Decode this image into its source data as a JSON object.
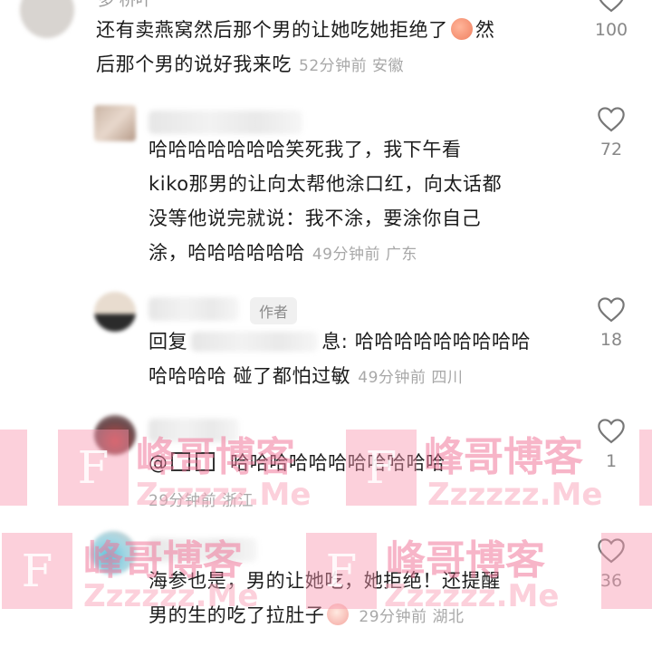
{
  "comments": [
    {
      "text_line1": "还有卖燕窝然后那个男的让她吃她拒绝了",
      "text_line2_prefix": "然",
      "text_line2": "后那个男的说好我来吃",
      "meta": "52分钟前 安徽",
      "emoji_icon": "peach-face-emoji",
      "likes": "100"
    },
    {
      "lines": [
        "哈哈哈哈哈哈哈笑死我了，我下午看",
        "kiko那男的让向太帮他涂口红，向太话都",
        "没等他说完就说：我不涂，要涂你自己"
      ],
      "last_line": "涂，哈哈哈哈哈哈",
      "meta": "49分钟前 广东",
      "likes": "72"
    },
    {
      "author_tag": "作者",
      "reply_prefix": "回复",
      "line1_suffix": "息: 哈哈哈哈哈哈哈哈哈",
      "line2": "哈哈哈哈 碰了都怕过敏",
      "meta": "49分钟前 四川",
      "likes": "18"
    },
    {
      "mention": "@",
      "text": "哈哈哈哈哈哈哈哈哈哈哈",
      "meta": "29分钟前 浙江",
      "likes": "1"
    },
    {
      "line1": "海参也是，男的让她吃，她拒绝！还提醒",
      "line2": "男的生的吃了拉肚子",
      "emoji_icon": "laughing-crying-emoji",
      "meta": "29分钟前 湖北",
      "likes": "36"
    }
  ],
  "top_partial": "多 桥叶",
  "watermark": {
    "letter": "F",
    "title": "峰哥博客",
    "site": "Zzzzzz.Me"
  },
  "colors": {
    "text": "#1c1c1c",
    "meta": "#a8a8a8",
    "like_count": "#888888",
    "watermark": "#f296ad"
  }
}
